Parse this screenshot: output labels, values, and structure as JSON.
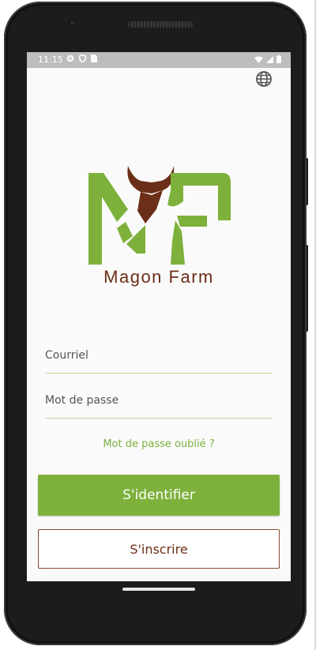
{
  "status_bar": {
    "time": "11:15",
    "left_icons": [
      "gear-icon",
      "shield-icon",
      "sim-card-icon"
    ],
    "right_icons": [
      "wifi-icon",
      "signal-icon",
      "battery-icon"
    ]
  },
  "header": {
    "language_icon": "globe-icon"
  },
  "brand": {
    "logo_letters": "MF",
    "name": "Magon Farm",
    "colors": {
      "green": "#7db13c",
      "brown": "#6b2e17"
    }
  },
  "form": {
    "email_placeholder": "Courriel",
    "password_placeholder": "Mot de passe",
    "forgot_password": "Mot de passe oublié ?",
    "login_label": "S'identifier",
    "register_label": "S'inscrire"
  }
}
